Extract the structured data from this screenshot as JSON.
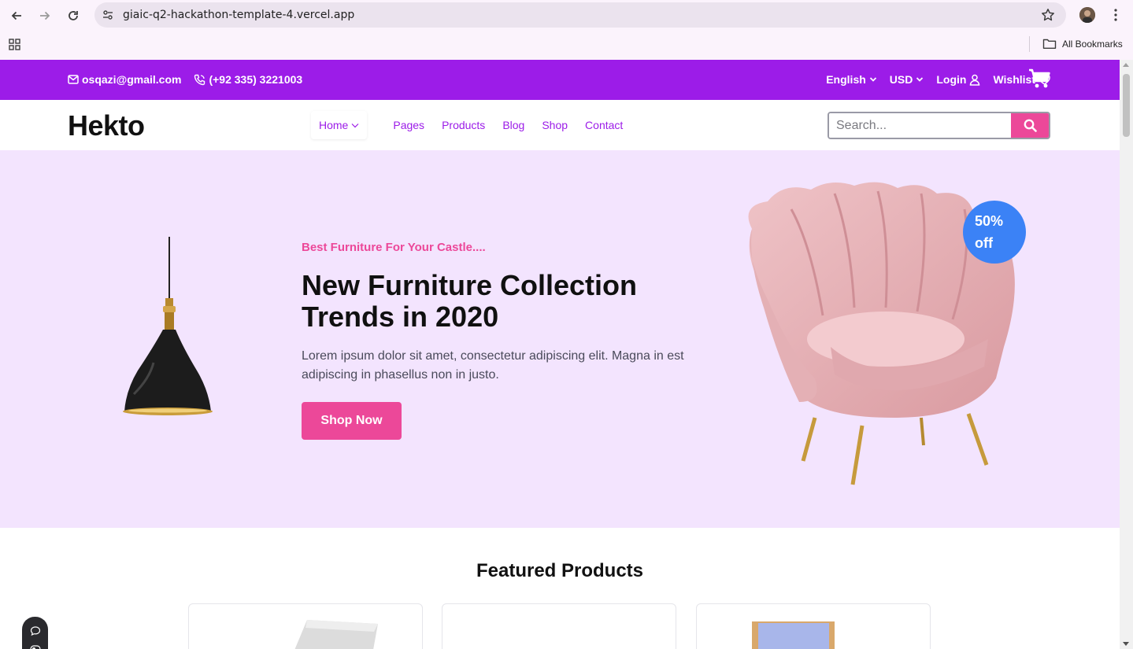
{
  "browser": {
    "url": "giaic-q2-hackathon-template-4.vercel.app",
    "bookmarks_label": "All Bookmarks"
  },
  "topbar": {
    "email": "osqazi@gmail.com",
    "phone": "(+92 335) 3221003",
    "language": "English",
    "currency": "USD",
    "login": "Login",
    "wishlist": "Wishlist",
    "color": "#9c1ce8"
  },
  "header": {
    "logo": "Hekto",
    "nav": {
      "home": "Home",
      "pages": "Pages",
      "products": "Products",
      "blog": "Blog",
      "shop": "Shop",
      "contact": "Contact"
    },
    "search_placeholder": "Search..."
  },
  "hero": {
    "eyebrow": "Best Furniture For Your Castle....",
    "title_line1": "New Furniture Collection",
    "title_line2": "Trends in 2020",
    "description": "Lorem ipsum dolor sit amet, consectetur adipiscing elit. Magna in est adipiscing in phasellus non in justo.",
    "cta": "Shop Now",
    "badge_line1": "50%",
    "badge_line2": "off",
    "accent": "#ec4899",
    "background": "#f3e4fe"
  },
  "featured": {
    "title": "Featured Products"
  }
}
